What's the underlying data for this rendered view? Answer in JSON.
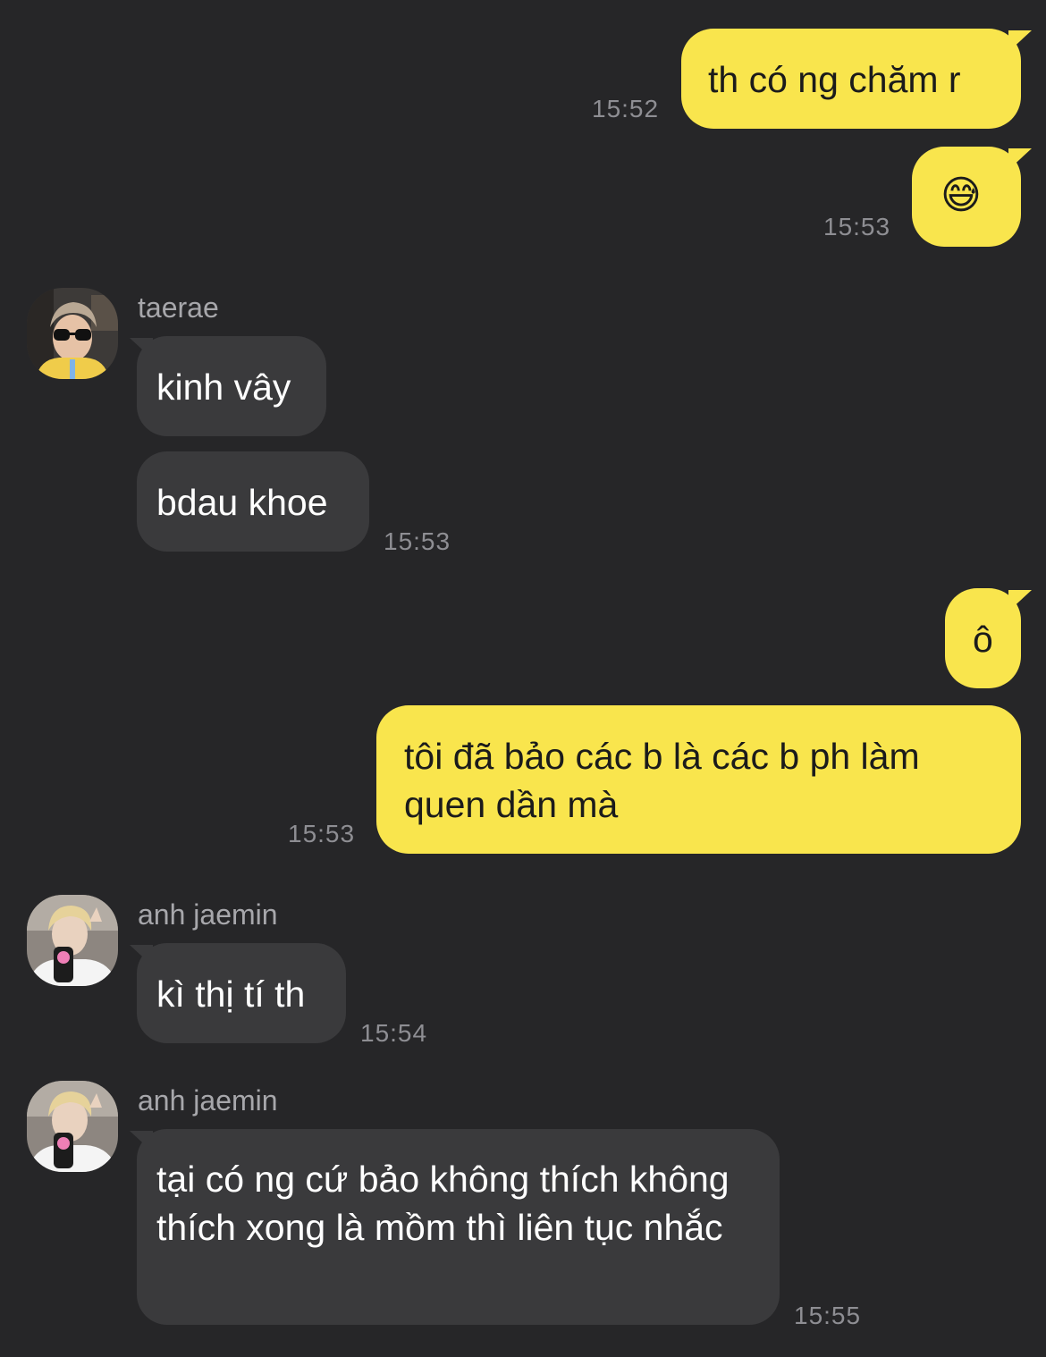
{
  "messages": [
    {
      "text": "th có ng chăm r",
      "time": "15:52"
    },
    {
      "text": "😅",
      "time": "15:53"
    },
    {
      "sender": "taerae",
      "text": "kinh vây"
    },
    {
      "text": "bdau khoe",
      "time": "15:53"
    },
    {
      "text": "ô"
    },
    {
      "text": "tôi đã bảo các b là các b ph làm quen dần mà",
      "time": "15:53"
    },
    {
      "sender": "anh jaemin",
      "text": "kì thị tí th",
      "time": "15:54"
    },
    {
      "sender": "anh jaemin",
      "text": "tại có ng cứ bảo không thích không thích xong là mồm thì liên tục nhắc",
      "time": "15:55"
    }
  ],
  "colors": {
    "background": "#262628",
    "outgoing_bubble": "#f9e54d",
    "incoming_bubble": "#3a3a3c",
    "timestamp": "#8e8e93"
  }
}
